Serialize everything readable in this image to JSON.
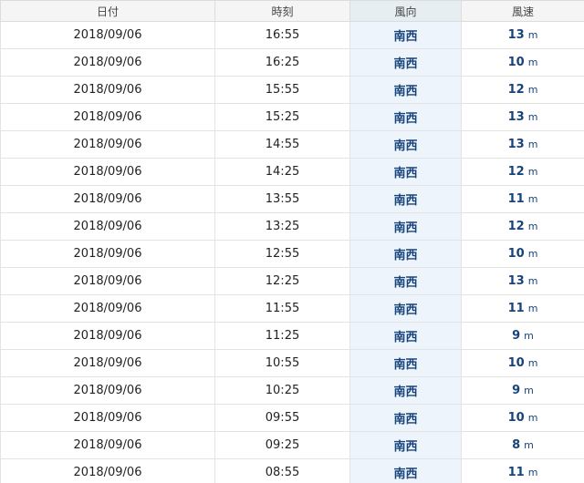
{
  "headers": {
    "date": "日付",
    "time": "時刻",
    "direction": "風向",
    "speed": "風速"
  },
  "rows": [
    {
      "date": "2018/09/06",
      "time": "16:55",
      "direction": "南西",
      "speed": "13",
      "unit": "m"
    },
    {
      "date": "2018/09/06",
      "time": "16:25",
      "direction": "南西",
      "speed": "10",
      "unit": "m"
    },
    {
      "date": "2018/09/06",
      "time": "15:55",
      "direction": "南西",
      "speed": "12",
      "unit": "m"
    },
    {
      "date": "2018/09/06",
      "time": "15:25",
      "direction": "南西",
      "speed": "13",
      "unit": "m"
    },
    {
      "date": "2018/09/06",
      "time": "14:55",
      "direction": "南西",
      "speed": "13",
      "unit": "m"
    },
    {
      "date": "2018/09/06",
      "time": "14:25",
      "direction": "南西",
      "speed": "12",
      "unit": "m"
    },
    {
      "date": "2018/09/06",
      "time": "13:55",
      "direction": "南西",
      "speed": "11",
      "unit": "m"
    },
    {
      "date": "2018/09/06",
      "time": "13:25",
      "direction": "南西",
      "speed": "12",
      "unit": "m"
    },
    {
      "date": "2018/09/06",
      "time": "12:55",
      "direction": "南西",
      "speed": "10",
      "unit": "m"
    },
    {
      "date": "2018/09/06",
      "time": "12:25",
      "direction": "南西",
      "speed": "13",
      "unit": "m"
    },
    {
      "date": "2018/09/06",
      "time": "11:55",
      "direction": "南西",
      "speed": "11",
      "unit": "m"
    },
    {
      "date": "2018/09/06",
      "time": "11:25",
      "direction": "南西",
      "speed": "9",
      "unit": "m"
    },
    {
      "date": "2018/09/06",
      "time": "10:55",
      "direction": "南西",
      "speed": "10",
      "unit": "m"
    },
    {
      "date": "2018/09/06",
      "time": "10:25",
      "direction": "南西",
      "speed": "9",
      "unit": "m"
    },
    {
      "date": "2018/09/06",
      "time": "09:55",
      "direction": "南西",
      "speed": "10",
      "unit": "m"
    },
    {
      "date": "2018/09/06",
      "time": "09:25",
      "direction": "南西",
      "speed": "8",
      "unit": "m"
    },
    {
      "date": "2018/09/06",
      "time": "08:55",
      "direction": "南西",
      "speed": "11",
      "unit": "m"
    }
  ],
  "colors": {
    "accent_text": "#17437a",
    "direction_bg": "#eef4fb",
    "header_bg": "#f5f5f5"
  }
}
